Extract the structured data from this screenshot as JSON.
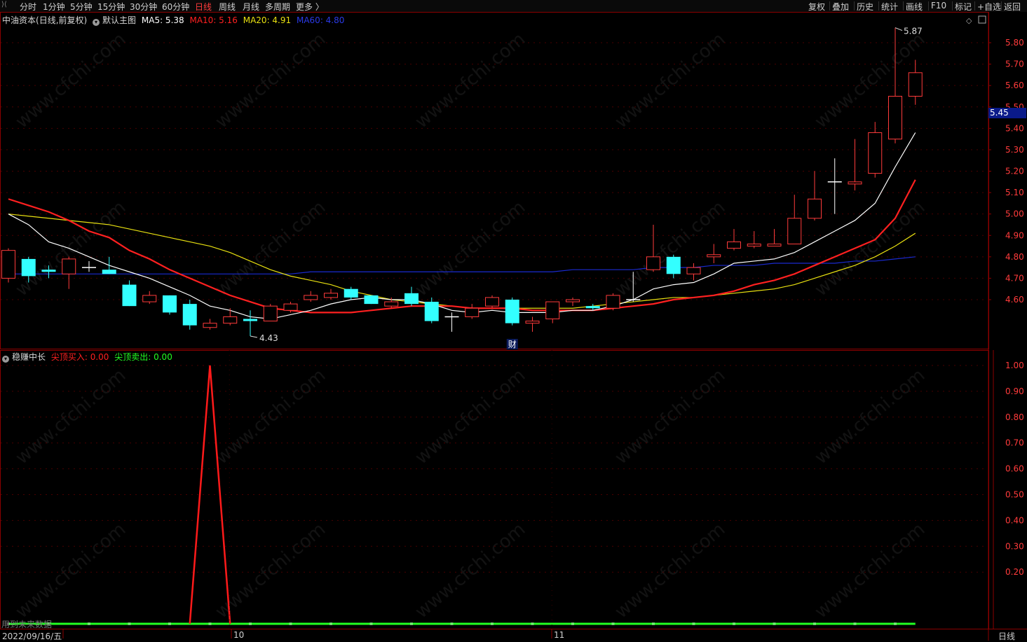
{
  "toolbar": {
    "periods": [
      {
        "label": "分时"
      },
      {
        "label": "1分钟"
      },
      {
        "label": "5分钟"
      },
      {
        "label": "15分钟"
      },
      {
        "label": "30分钟"
      },
      {
        "label": "60分钟"
      },
      {
        "label": "日线",
        "active": true
      },
      {
        "label": "周线"
      },
      {
        "label": "月线"
      },
      {
        "label": "多周期"
      },
      {
        "label": "更多 〉"
      }
    ],
    "right_buttons": [
      "复权",
      "叠加",
      "历史",
      "统计",
      "画线",
      "F10",
      "标记",
      "+自选",
      "返回"
    ]
  },
  "main_header": {
    "stock_name": "中油资本",
    "mode": "(日线,前复权)",
    "template": "默认主图",
    "ma5_label": "MA5: 5.38",
    "ma10_label": "MA10: 5.16",
    "ma20_label": "MA20: 4.91",
    "ma60_label": "MA60: 4.80"
  },
  "indicator_header": {
    "name": "稳赚中长",
    "buy_label": "尖顶买入: 0.00",
    "sell_label": "尖顶卖出: 0.00"
  },
  "annotations": {
    "high_label": "5.87",
    "low_label": "4.43",
    "current_price": "5.45",
    "event_marker": "财",
    "future_data_note": "用到未来数据"
  },
  "footer": {
    "date": "2022/09/16/五",
    "month_labels": [
      "10",
      "11"
    ],
    "period_label": "日线"
  },
  "watermark": "www.cfchi.com",
  "colors": {
    "ma5": "#ffffff",
    "ma10": "#ff2020",
    "ma20": "#e8e010",
    "ma60": "#1a2ad0",
    "up": "#ff3b3b",
    "down": "#33ffff",
    "border": "#8b0000",
    "buy_line": "#ff1a1a",
    "sell_line": "#22ff22"
  },
  "chart_data": [
    {
      "type": "candlestick",
      "y_ticks": [
        "5.80",
        "5.70",
        "5.60",
        "5.50",
        "5.40",
        "5.30",
        "5.20",
        "5.10",
        "5.00",
        "4.90",
        "4.80",
        "4.70",
        "4.60"
      ],
      "ylim": [
        4.38,
        5.92
      ],
      "candles": [
        {
          "o": 4.7,
          "c": 4.83,
          "h": 4.84,
          "l": 4.68
        },
        {
          "o": 4.79,
          "c": 4.71,
          "h": 4.8,
          "l": 4.68
        },
        {
          "o": 4.74,
          "c": 4.73,
          "h": 4.76,
          "l": 4.7
        },
        {
          "o": 4.72,
          "c": 4.79,
          "h": 4.8,
          "l": 4.65
        },
        {
          "o": 4.75,
          "c": 4.75,
          "h": 4.78,
          "l": 4.73
        },
        {
          "o": 4.74,
          "c": 4.72,
          "h": 4.8,
          "l": 4.72
        },
        {
          "o": 4.67,
          "c": 4.57,
          "h": 4.69,
          "l": 4.57
        },
        {
          "o": 4.59,
          "c": 4.62,
          "h": 4.64,
          "l": 4.58
        },
        {
          "o": 4.62,
          "c": 4.54,
          "h": 4.62,
          "l": 4.53
        },
        {
          "o": 4.58,
          "c": 4.48,
          "h": 4.6,
          "l": 4.46
        },
        {
          "o": 4.47,
          "c": 4.49,
          "h": 4.51,
          "l": 4.46
        },
        {
          "o": 4.49,
          "c": 4.52,
          "h": 4.56,
          "l": 4.48
        },
        {
          "o": 4.51,
          "c": 4.5,
          "h": 4.55,
          "l": 4.43
        },
        {
          "o": 4.5,
          "c": 4.57,
          "h": 4.58,
          "l": 4.5
        },
        {
          "o": 4.55,
          "c": 4.58,
          "h": 4.59,
          "l": 4.54
        },
        {
          "o": 4.6,
          "c": 4.62,
          "h": 4.64,
          "l": 4.59
        },
        {
          "o": 4.61,
          "c": 4.63,
          "h": 4.65,
          "l": 4.6
        },
        {
          "o": 4.65,
          "c": 4.61,
          "h": 4.66,
          "l": 4.6
        },
        {
          "o": 4.62,
          "c": 4.58,
          "h": 4.62,
          "l": 4.58
        },
        {
          "o": 4.57,
          "c": 4.59,
          "h": 4.61,
          "l": 4.56
        },
        {
          "o": 4.63,
          "c": 4.58,
          "h": 4.66,
          "l": 4.57
        },
        {
          "o": 4.59,
          "c": 4.5,
          "h": 4.61,
          "l": 4.49
        },
        {
          "o": 4.52,
          "c": 4.52,
          "h": 4.54,
          "l": 4.45
        },
        {
          "o": 4.52,
          "c": 4.56,
          "h": 4.58,
          "l": 4.51
        },
        {
          "o": 4.57,
          "c": 4.61,
          "h": 4.62,
          "l": 4.56
        },
        {
          "o": 4.6,
          "c": 4.49,
          "h": 4.61,
          "l": 4.48
        },
        {
          "o": 4.49,
          "c": 4.5,
          "h": 4.52,
          "l": 4.45
        },
        {
          "o": 4.51,
          "c": 4.59,
          "h": 4.59,
          "l": 4.49
        },
        {
          "o": 4.59,
          "c": 4.6,
          "h": 4.61,
          "l": 4.57
        },
        {
          "o": 4.57,
          "c": 4.56,
          "h": 4.58,
          "l": 4.55
        },
        {
          "o": 4.56,
          "c": 4.62,
          "h": 4.63,
          "l": 4.55
        },
        {
          "o": 4.6,
          "c": 4.6,
          "h": 4.73,
          "l": 4.59
        },
        {
          "o": 4.74,
          "c": 4.8,
          "h": 4.95,
          "l": 4.73
        },
        {
          "o": 4.8,
          "c": 4.72,
          "h": 4.81,
          "l": 4.7
        },
        {
          "o": 4.72,
          "c": 4.75,
          "h": 4.77,
          "l": 4.69
        },
        {
          "o": 4.8,
          "c": 4.81,
          "h": 4.86,
          "l": 4.77
        },
        {
          "o": 4.84,
          "c": 4.87,
          "h": 4.93,
          "l": 4.83
        },
        {
          "o": 4.85,
          "c": 4.86,
          "h": 4.92,
          "l": 4.84
        },
        {
          "o": 4.85,
          "c": 4.86,
          "h": 4.93,
          "l": 4.85
        },
        {
          "o": 4.86,
          "c": 4.98,
          "h": 5.09,
          "l": 4.86
        },
        {
          "o": 4.98,
          "c": 5.07,
          "h": 5.2,
          "l": 4.97
        },
        {
          "o": 5.15,
          "c": 5.15,
          "h": 5.26,
          "l": 5.0
        },
        {
          "o": 5.14,
          "c": 5.15,
          "h": 5.35,
          "l": 5.11
        },
        {
          "o": 5.19,
          "c": 5.38,
          "h": 5.43,
          "l": 5.17
        },
        {
          "o": 5.35,
          "c": 5.55,
          "h": 5.87,
          "l": 5.33
        },
        {
          "o": 5.55,
          "c": 5.66,
          "h": 5.72,
          "l": 5.51
        }
      ],
      "ma5": [
        5.0,
        4.95,
        4.87,
        4.84,
        4.8,
        4.76,
        4.73,
        4.7,
        4.66,
        4.62,
        4.57,
        4.55,
        4.52,
        4.51,
        4.53,
        4.55,
        4.58,
        4.6,
        4.61,
        4.6,
        4.6,
        4.58,
        4.55,
        4.54,
        4.55,
        4.54,
        4.54,
        4.54,
        4.55,
        4.55,
        4.57,
        4.6,
        4.65,
        4.67,
        4.68,
        4.72,
        4.77,
        4.78,
        4.79,
        4.82,
        4.87,
        4.92,
        4.97,
        5.05,
        5.22,
        5.38
      ],
      "ma10": [
        5.07,
        5.04,
        5.01,
        4.97,
        4.92,
        4.89,
        4.83,
        4.79,
        4.74,
        4.7,
        4.66,
        4.62,
        4.59,
        4.56,
        4.55,
        4.54,
        4.54,
        4.54,
        4.55,
        4.56,
        4.57,
        4.57,
        4.57,
        4.56,
        4.56,
        4.56,
        4.55,
        4.55,
        4.55,
        4.55,
        4.56,
        4.57,
        4.58,
        4.6,
        4.61,
        4.62,
        4.64,
        4.67,
        4.69,
        4.72,
        4.76,
        4.8,
        4.84,
        4.88,
        4.98,
        5.16
      ],
      "ma20": [
        5.0,
        4.99,
        4.98,
        4.97,
        4.96,
        4.95,
        4.93,
        4.91,
        4.89,
        4.87,
        4.85,
        4.82,
        4.78,
        4.74,
        4.71,
        4.69,
        4.67,
        4.64,
        4.62,
        4.6,
        4.59,
        4.58,
        4.57,
        4.56,
        4.56,
        4.56,
        4.56,
        4.56,
        4.56,
        4.57,
        4.58,
        4.59,
        4.6,
        4.61,
        4.61,
        4.62,
        4.63,
        4.64,
        4.65,
        4.67,
        4.7,
        4.73,
        4.76,
        4.8,
        4.85,
        4.91
      ],
      "ma60": [
        4.72,
        4.72,
        4.72,
        4.72,
        4.72,
        4.72,
        4.72,
        4.72,
        4.72,
        4.72,
        4.72,
        4.72,
        4.72,
        4.72,
        4.72,
        4.73,
        4.73,
        4.73,
        4.73,
        4.73,
        4.73,
        4.73,
        4.73,
        4.73,
        4.73,
        4.73,
        4.73,
        4.73,
        4.74,
        4.74,
        4.74,
        4.74,
        4.75,
        4.75,
        4.75,
        4.76,
        4.76,
        4.76,
        4.77,
        4.77,
        4.77,
        4.77,
        4.78,
        4.78,
        4.79,
        4.8
      ]
    },
    {
      "type": "line",
      "title": "稳赚中长",
      "y_ticks": [
        "1.00",
        "0.90",
        "0.80",
        "0.70",
        "0.60",
        "0.50",
        "0.40",
        "0.30",
        "0.20"
      ],
      "ylim": [
        0,
        1.0
      ],
      "series": [
        {
          "name": "尖顶买入",
          "values": [
            0,
            0,
            0,
            0,
            0,
            0,
            0,
            0,
            0,
            0,
            1,
            0,
            0,
            0,
            0,
            0,
            0,
            0,
            0,
            0,
            0,
            0,
            0,
            0,
            0,
            0,
            0,
            0,
            0,
            0,
            0,
            0,
            0,
            0,
            0,
            0,
            0,
            0,
            0,
            0,
            0,
            0,
            0,
            0,
            0,
            0
          ]
        },
        {
          "name": "尖顶卖出",
          "values": [
            0,
            0,
            0,
            0,
            0,
            0,
            0,
            0,
            0,
            0,
            0,
            0,
            0,
            0,
            0,
            0,
            0,
            0,
            0,
            0,
            0,
            0,
            0,
            0,
            0,
            0,
            0,
            0,
            0,
            0,
            0,
            0,
            0,
            0,
            0,
            0,
            0,
            0,
            0,
            0,
            0,
            0,
            0,
            0,
            0,
            0
          ]
        }
      ]
    }
  ]
}
